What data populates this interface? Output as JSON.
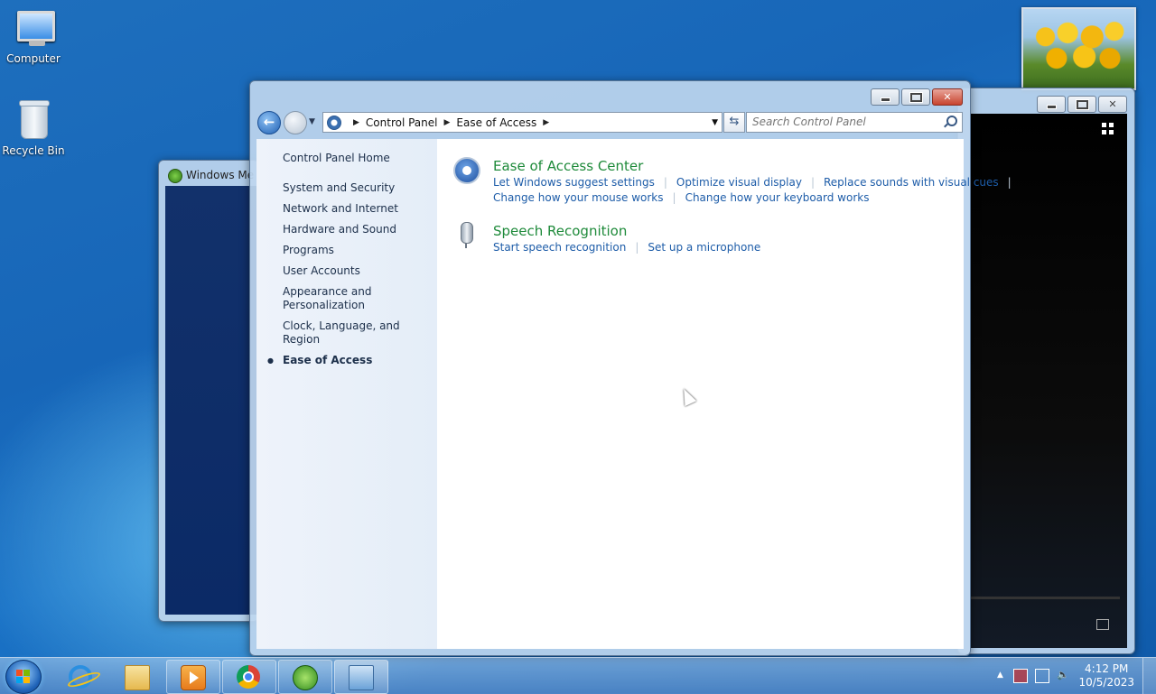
{
  "desktop": {
    "icons": [
      {
        "label": "Computer"
      },
      {
        "label": "Recycle Bin"
      }
    ]
  },
  "wmc_window": {
    "title": "Windows Me"
  },
  "control_panel": {
    "breadcrumb": [
      "Control Panel",
      "Ease of Access"
    ],
    "search_placeholder": "Search Control Panel",
    "sidebar": {
      "home": "Control Panel Home",
      "items": [
        "System and Security",
        "Network and Internet",
        "Hardware and Sound",
        "Programs",
        "User Accounts",
        "Appearance and Personalization",
        "Clock, Language, and Region",
        "Ease of Access"
      ],
      "current_index": 7
    },
    "categories": [
      {
        "title": "Ease of Access Center",
        "icon": "ease-of-access-icon",
        "links": [
          "Let Windows suggest settings",
          "Optimize visual display",
          "Replace sounds with visual cues",
          "Change how your mouse works",
          "Change how your keyboard works"
        ]
      },
      {
        "title": "Speech Recognition",
        "icon": "microphone-icon",
        "links": [
          "Start speech recognition",
          "Set up a microphone"
        ]
      }
    ]
  },
  "taskbar": {
    "clock_time": "4:12 PM",
    "clock_date": "10/5/2023"
  }
}
